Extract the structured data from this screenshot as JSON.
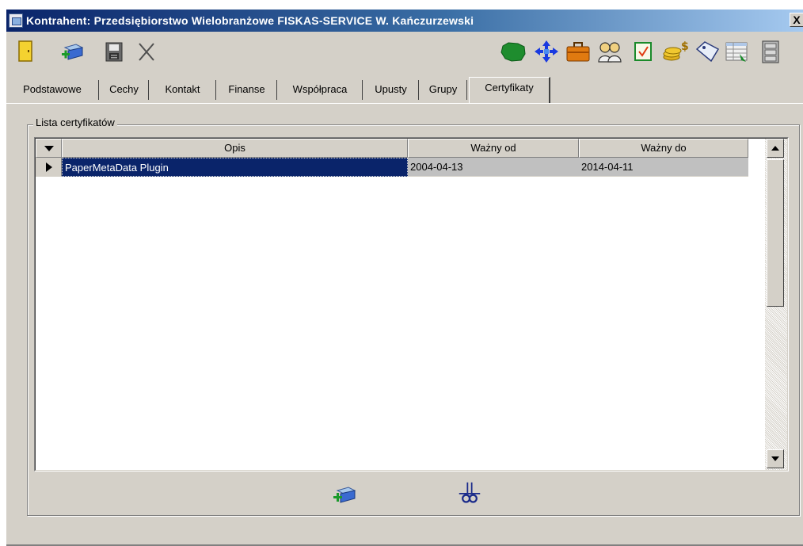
{
  "window": {
    "title": "Kontrahent: Przedsiębiorstwo Wielobranżowe FISKAS-SERVICE W. Kańczurzewski",
    "close_label": "X"
  },
  "toolbar": {
    "left_icons": [
      "exit-door-icon",
      "add-item-icon",
      "save-icon",
      "cancel-x-icon"
    ],
    "right_icons": [
      "map-poland-icon",
      "navigate-arrows-icon",
      "briefcase-icon",
      "contacts-people-icon",
      "checklist-icon",
      "coins-money-icon",
      "tag-label-icon",
      "table-grid-icon",
      "filing-cabinet-icon"
    ]
  },
  "tabs": [
    {
      "label": "Podstawowe",
      "active": false
    },
    {
      "label": "Cechy",
      "active": false
    },
    {
      "label": "Kontakt",
      "active": false
    },
    {
      "label": "Finanse",
      "active": false
    },
    {
      "label": "Współpraca",
      "active": false
    },
    {
      "label": "Upusty",
      "active": false
    },
    {
      "label": "Grupy",
      "active": false
    },
    {
      "label": "Certyfikaty",
      "active": true
    }
  ],
  "group": {
    "legend": "Lista certyfikatów"
  },
  "grid": {
    "columns": [
      {
        "key": "opis",
        "label": "Opis"
      },
      {
        "key": "od",
        "label": "Ważny od"
      },
      {
        "key": "do",
        "label": "Ważny do"
      }
    ],
    "rows": [
      {
        "opis": "PaperMetaData Plugin",
        "od": "2004-04-13",
        "do": "2014-04-11",
        "selected": true
      }
    ]
  },
  "actions": {
    "icons": [
      "add-certificate-icon",
      "cut-scissors-icon"
    ]
  },
  "colors": {
    "selection_bg": "#0a246a",
    "row_bg": "#c0c0c0",
    "face": "#d4d0c8"
  }
}
